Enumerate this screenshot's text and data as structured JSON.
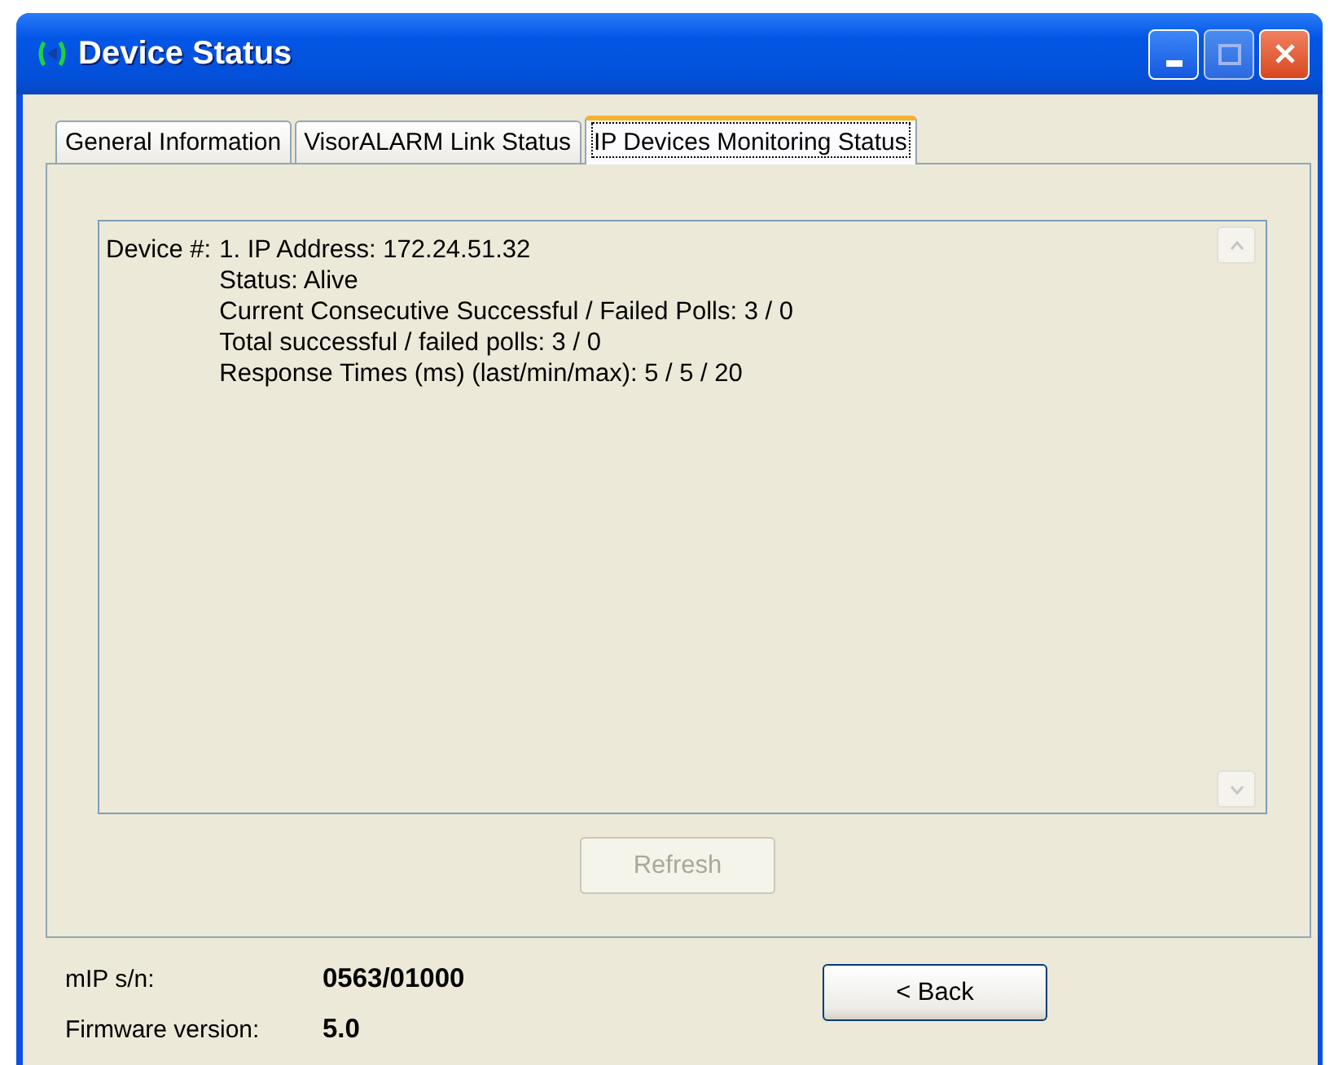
{
  "window": {
    "title": "Device Status"
  },
  "tabs": [
    {
      "label": "General Information",
      "selected": false
    },
    {
      "label": "VisorALARM Link Status",
      "selected": false
    },
    {
      "label": "IP Devices Monitoring Status",
      "selected": true
    }
  ],
  "devices": [
    {
      "label": "Device #:",
      "lines": [
        "1. IP Address: 172.24.51.32",
        "Status: Alive",
        "Current Consecutive Successful / Failed Polls: 3 / 0",
        "Total successful / failed polls: 3 / 0",
        "Response Times (ms) (last/min/max): 5 / 5 / 20"
      ]
    }
  ],
  "refresh_button": {
    "label": "Refresh",
    "disabled": true
  },
  "info": [
    {
      "label": "mIP s/n:",
      "value": "0563/01000"
    },
    {
      "label": "Firmware version:",
      "value": "5.0"
    }
  ],
  "back_button": {
    "label": "< Back"
  }
}
